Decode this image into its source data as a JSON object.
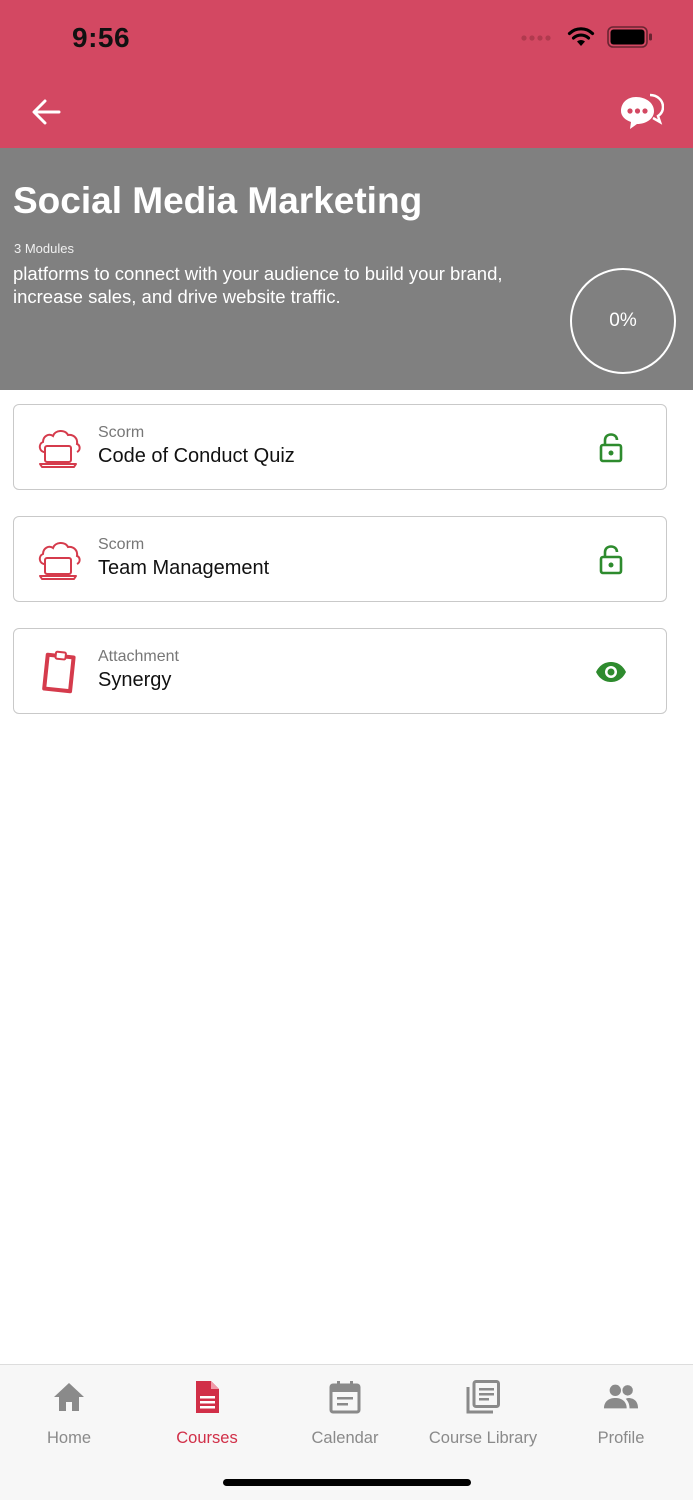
{
  "status_bar": {
    "time": "9:56"
  },
  "nav": {
    "back_icon": "arrow-left-icon",
    "chat_icon": "chat-bubbles-icon"
  },
  "course": {
    "title": "Social Media Marketing",
    "modules_count": "3 Modules",
    "description": "platforms to connect with your audience to build your brand, increase sales, and drive website traffic.",
    "progress": "0%"
  },
  "modules": [
    {
      "type": "Scorm",
      "name": "Code of Conduct Quiz",
      "icon": "cloud-laptop-icon",
      "status_icon": "unlocked-icon"
    },
    {
      "type": "Scorm",
      "name": "Team Management",
      "icon": "cloud-laptop-icon",
      "status_icon": "unlocked-icon"
    },
    {
      "type": "Attachment",
      "name": "Synergy",
      "icon": "clipboard-icon",
      "status_icon": "eye-icon"
    }
  ],
  "tabs": [
    {
      "label": "Home",
      "icon": "home-icon",
      "active": false
    },
    {
      "label": "Courses",
      "icon": "document-icon",
      "active": true
    },
    {
      "label": "Calendar",
      "icon": "calendar-icon",
      "active": false
    },
    {
      "label": "Course Library",
      "icon": "library-icon",
      "active": false
    },
    {
      "label": "Profile",
      "icon": "people-icon",
      "active": false
    }
  ],
  "colors": {
    "brand": "#d34862",
    "hero_bg": "#808080",
    "module_icon": "#d53b4c",
    "status_green": "#2e8b2e",
    "tab_active": "#d12f48",
    "tab_inactive": "#8a8a8a"
  }
}
